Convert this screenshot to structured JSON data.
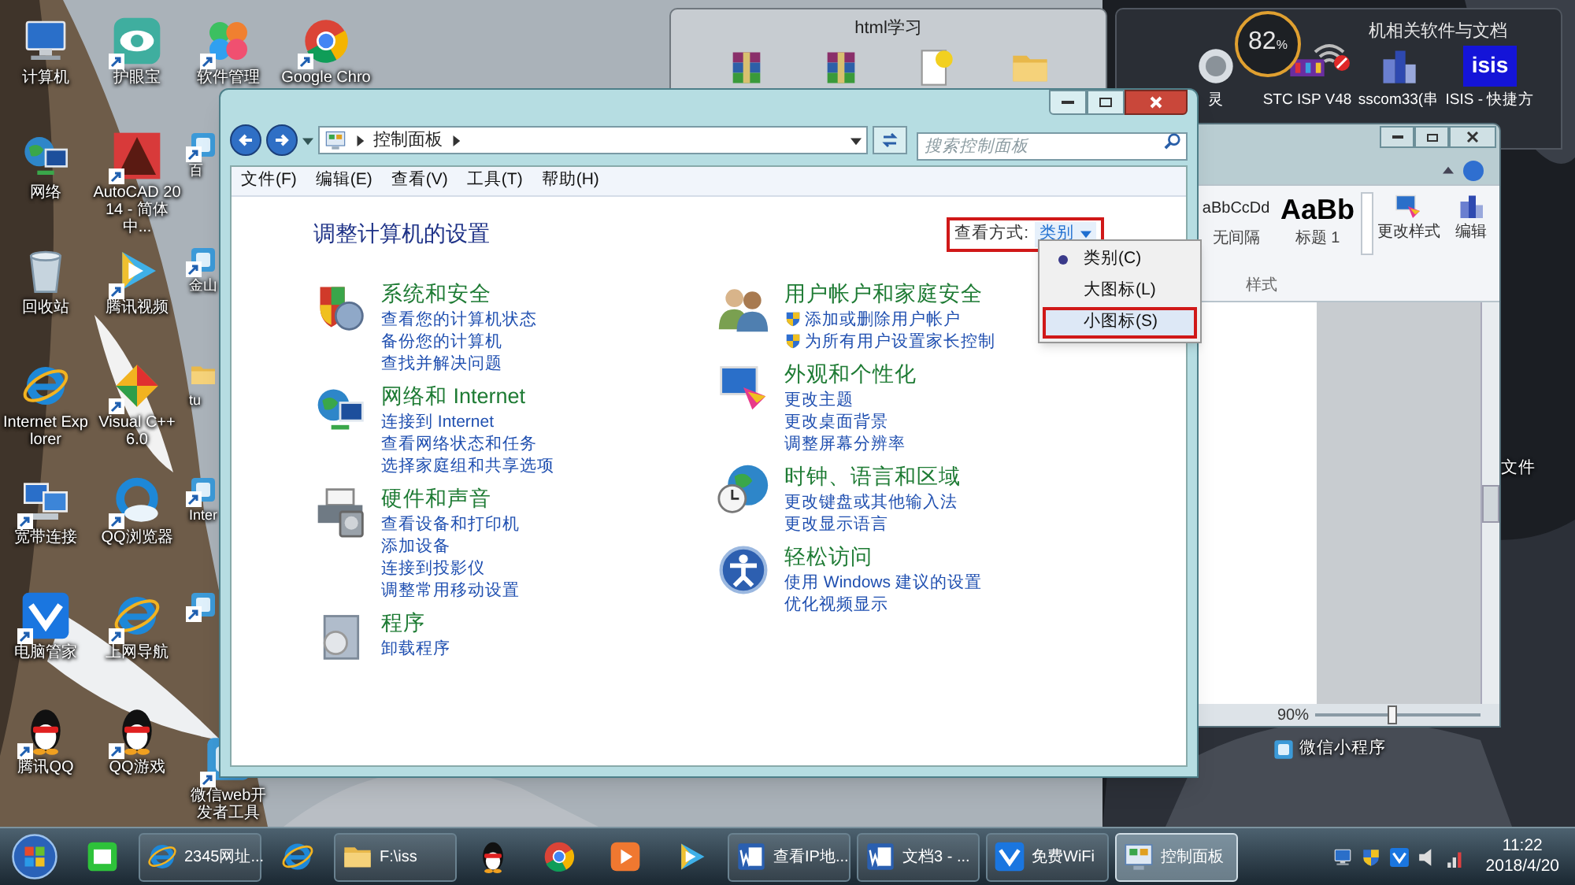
{
  "desktop_columns": [
    [
      {
        "label": "计算机",
        "kind": "computer",
        "shortcut": false
      },
      {
        "label": "网络",
        "kind": "network",
        "shortcut": false
      },
      {
        "label": "回收站",
        "kind": "trash",
        "shortcut": false
      },
      {
        "label": "Internet Explorer",
        "kind": "ie",
        "shortcut": false
      },
      {
        "label": "宽带连接",
        "kind": "computers",
        "shortcut": true
      },
      {
        "label": "电脑管家",
        "kind": "shield",
        "shortcut": true
      },
      {
        "label": "腾讯QQ",
        "kind": "penguin",
        "shortcut": true
      }
    ],
    [
      {
        "label": "护眼宝",
        "kind": "eye",
        "shortcut": true
      },
      {
        "label": "AutoCAD 2014 - 简体中...",
        "kind": "cad",
        "shortcut": true
      },
      {
        "label": "腾讯视频",
        "kind": "play",
        "shortcut": true
      },
      {
        "label": "Visual C++ 6.0",
        "kind": "vc",
        "shortcut": true
      },
      {
        "label": "QQ浏览器",
        "kind": "cloud",
        "shortcut": true
      },
      {
        "label": "上网导航",
        "kind": "ie",
        "shortcut": true
      },
      {
        "label": "QQ游戏",
        "kind": "penguin",
        "shortcut": true
      }
    ],
    [
      {
        "label": "软件管理",
        "kind": "petals",
        "shortcut": true
      },
      {
        "label": "百",
        "kind": "app",
        "shortcut": true
      },
      {
        "label": "金山",
        "kind": "app",
        "shortcut": true
      },
      {
        "label": "tu",
        "kind": "folder",
        "shortcut": false
      },
      {
        "label": "Inter",
        "kind": "app",
        "shortcut": true
      },
      {
        "kind": "app",
        "shortcut": true
      },
      {
        "label": "微信web开发者工具",
        "kind": "app",
        "shortcut": true
      }
    ],
    [
      {
        "label": "Google Chro",
        "kind": "chrome",
        "shortcut": true
      }
    ]
  ],
  "desktop_extras": [
    {
      "label": "文件"
    },
    {
      "label": "微信小程序"
    }
  ],
  "html_window": {
    "title": "html学习",
    "items": [
      {
        "kind": "archive"
      },
      {
        "kind": "archive"
      },
      {
        "kind": "document"
      },
      {
        "kind": "folder"
      }
    ]
  },
  "dark_window": {
    "title": "机相关软件与文档",
    "items": [
      {
        "label": "灵",
        "kind": "orb"
      },
      {
        "label": "STC ISP V48",
        "kind": "chip"
      },
      {
        "label": "sscom33(串",
        "kind": "buildings"
      },
      {
        "label": "ISIS - 快捷方",
        "kind": "logo",
        "logo_text": "isis"
      }
    ]
  },
  "speed_widget": {
    "value": "82",
    "unit": "%"
  },
  "word_window": {
    "styles": [
      {
        "sample": "aBbCcDd",
        "name": "无间隔"
      },
      {
        "sample": "AaBb",
        "name": "标题 1"
      }
    ],
    "buttons": [
      "更改样式",
      "编辑"
    ],
    "group": "样式",
    "zoom": {
      "reading": "90%",
      "level": 0.47
    }
  },
  "control_panel": {
    "address": "控制面板",
    "search_placeholder": "搜索控制面板",
    "menu": [
      "文件(F)",
      "编辑(E)",
      "查看(V)",
      "工具(T)",
      "帮助(H)"
    ],
    "heading": "调整计算机的设置",
    "view_by": {
      "label": "查看方式:",
      "value": "类别",
      "annotated": true
    },
    "view_menu": [
      {
        "label": "类别(C)",
        "selected": true,
        "hovered": false,
        "annotated": false
      },
      {
        "label": "大图标(L)",
        "selected": false,
        "hovered": false,
        "annotated": false
      },
      {
        "label": "小图标(S)",
        "selected": false,
        "hovered": true,
        "annotated": true
      }
    ],
    "columns": [
      [
        {
          "title": "系统和安全",
          "kind": "shield-chart",
          "links": [
            {
              "text": "查看您的计算机状态",
              "uac": false
            },
            {
              "text": "备份您的计算机",
              "uac": false
            },
            {
              "text": "查找并解决问题",
              "uac": false
            }
          ]
        },
        {
          "title": "网络和 Internet",
          "kind": "network",
          "links": [
            {
              "text": "连接到 Internet",
              "uac": false
            },
            {
              "text": "查看网络状态和任务",
              "uac": false
            },
            {
              "text": "选择家庭组和共享选项",
              "uac": false
            }
          ]
        },
        {
          "title": "硬件和声音",
          "kind": "printer",
          "links": [
            {
              "text": "查看设备和打印机",
              "uac": false
            },
            {
              "text": "添加设备",
              "uac": false
            },
            {
              "text": "连接到投影仪",
              "uac": false
            },
            {
              "text": "调整常用移动设置",
              "uac": false
            }
          ]
        },
        {
          "title": "程序",
          "kind": "software",
          "links": [
            {
              "text": "卸载程序",
              "uac": false
            }
          ]
        }
      ],
      [
        {
          "title": "用户帐户和家庭安全",
          "kind": "users",
          "links": [
            {
              "text": "添加或删除用户帐户",
              "uac": true
            },
            {
              "text": "为所有用户设置家长控制",
              "uac": true
            }
          ]
        },
        {
          "title": "外观和个性化",
          "kind": "palette",
          "links": [
            {
              "text": "更改主题",
              "uac": false
            },
            {
              "text": "更改桌面背景",
              "uac": false
            },
            {
              "text": "调整屏幕分辨率",
              "uac": false
            }
          ]
        },
        {
          "title": "时钟、语言和区域",
          "kind": "clock",
          "links": [
            {
              "text": "更改键盘或其他输入法",
              "uac": false
            },
            {
              "text": "更改显示语言",
              "uac": false
            }
          ]
        },
        {
          "title": "轻松访问",
          "kind": "access",
          "links": [
            {
              "text": "使用 Windows 建议的设置",
              "uac": false
            },
            {
              "text": "优化视频显示",
              "uac": false
            }
          ]
        }
      ]
    ]
  },
  "taskbar": {
    "items": [
      {
        "kind": "start"
      },
      {
        "kind": "iqiyi"
      },
      {
        "kind": "ie",
        "label": "2345网址...",
        "active": false
      },
      {
        "kind": "ie"
      },
      {
        "kind": "folder",
        "label": "F:\\iss",
        "active": false
      },
      {
        "kind": "penguin"
      },
      {
        "kind": "chrome"
      },
      {
        "kind": "media"
      },
      {
        "kind": "play"
      },
      {
        "kind": "word",
        "label": "查看IP地...",
        "active": false
      },
      {
        "kind": "word",
        "label": "文档3 - ...",
        "active": false
      },
      {
        "kind": "shield",
        "label": "免费WiFi",
        "active": false
      },
      {
        "kind": "control",
        "label": "控制面板",
        "active": true
      }
    ],
    "time": "11:22",
    "date": "2018/4/20"
  }
}
